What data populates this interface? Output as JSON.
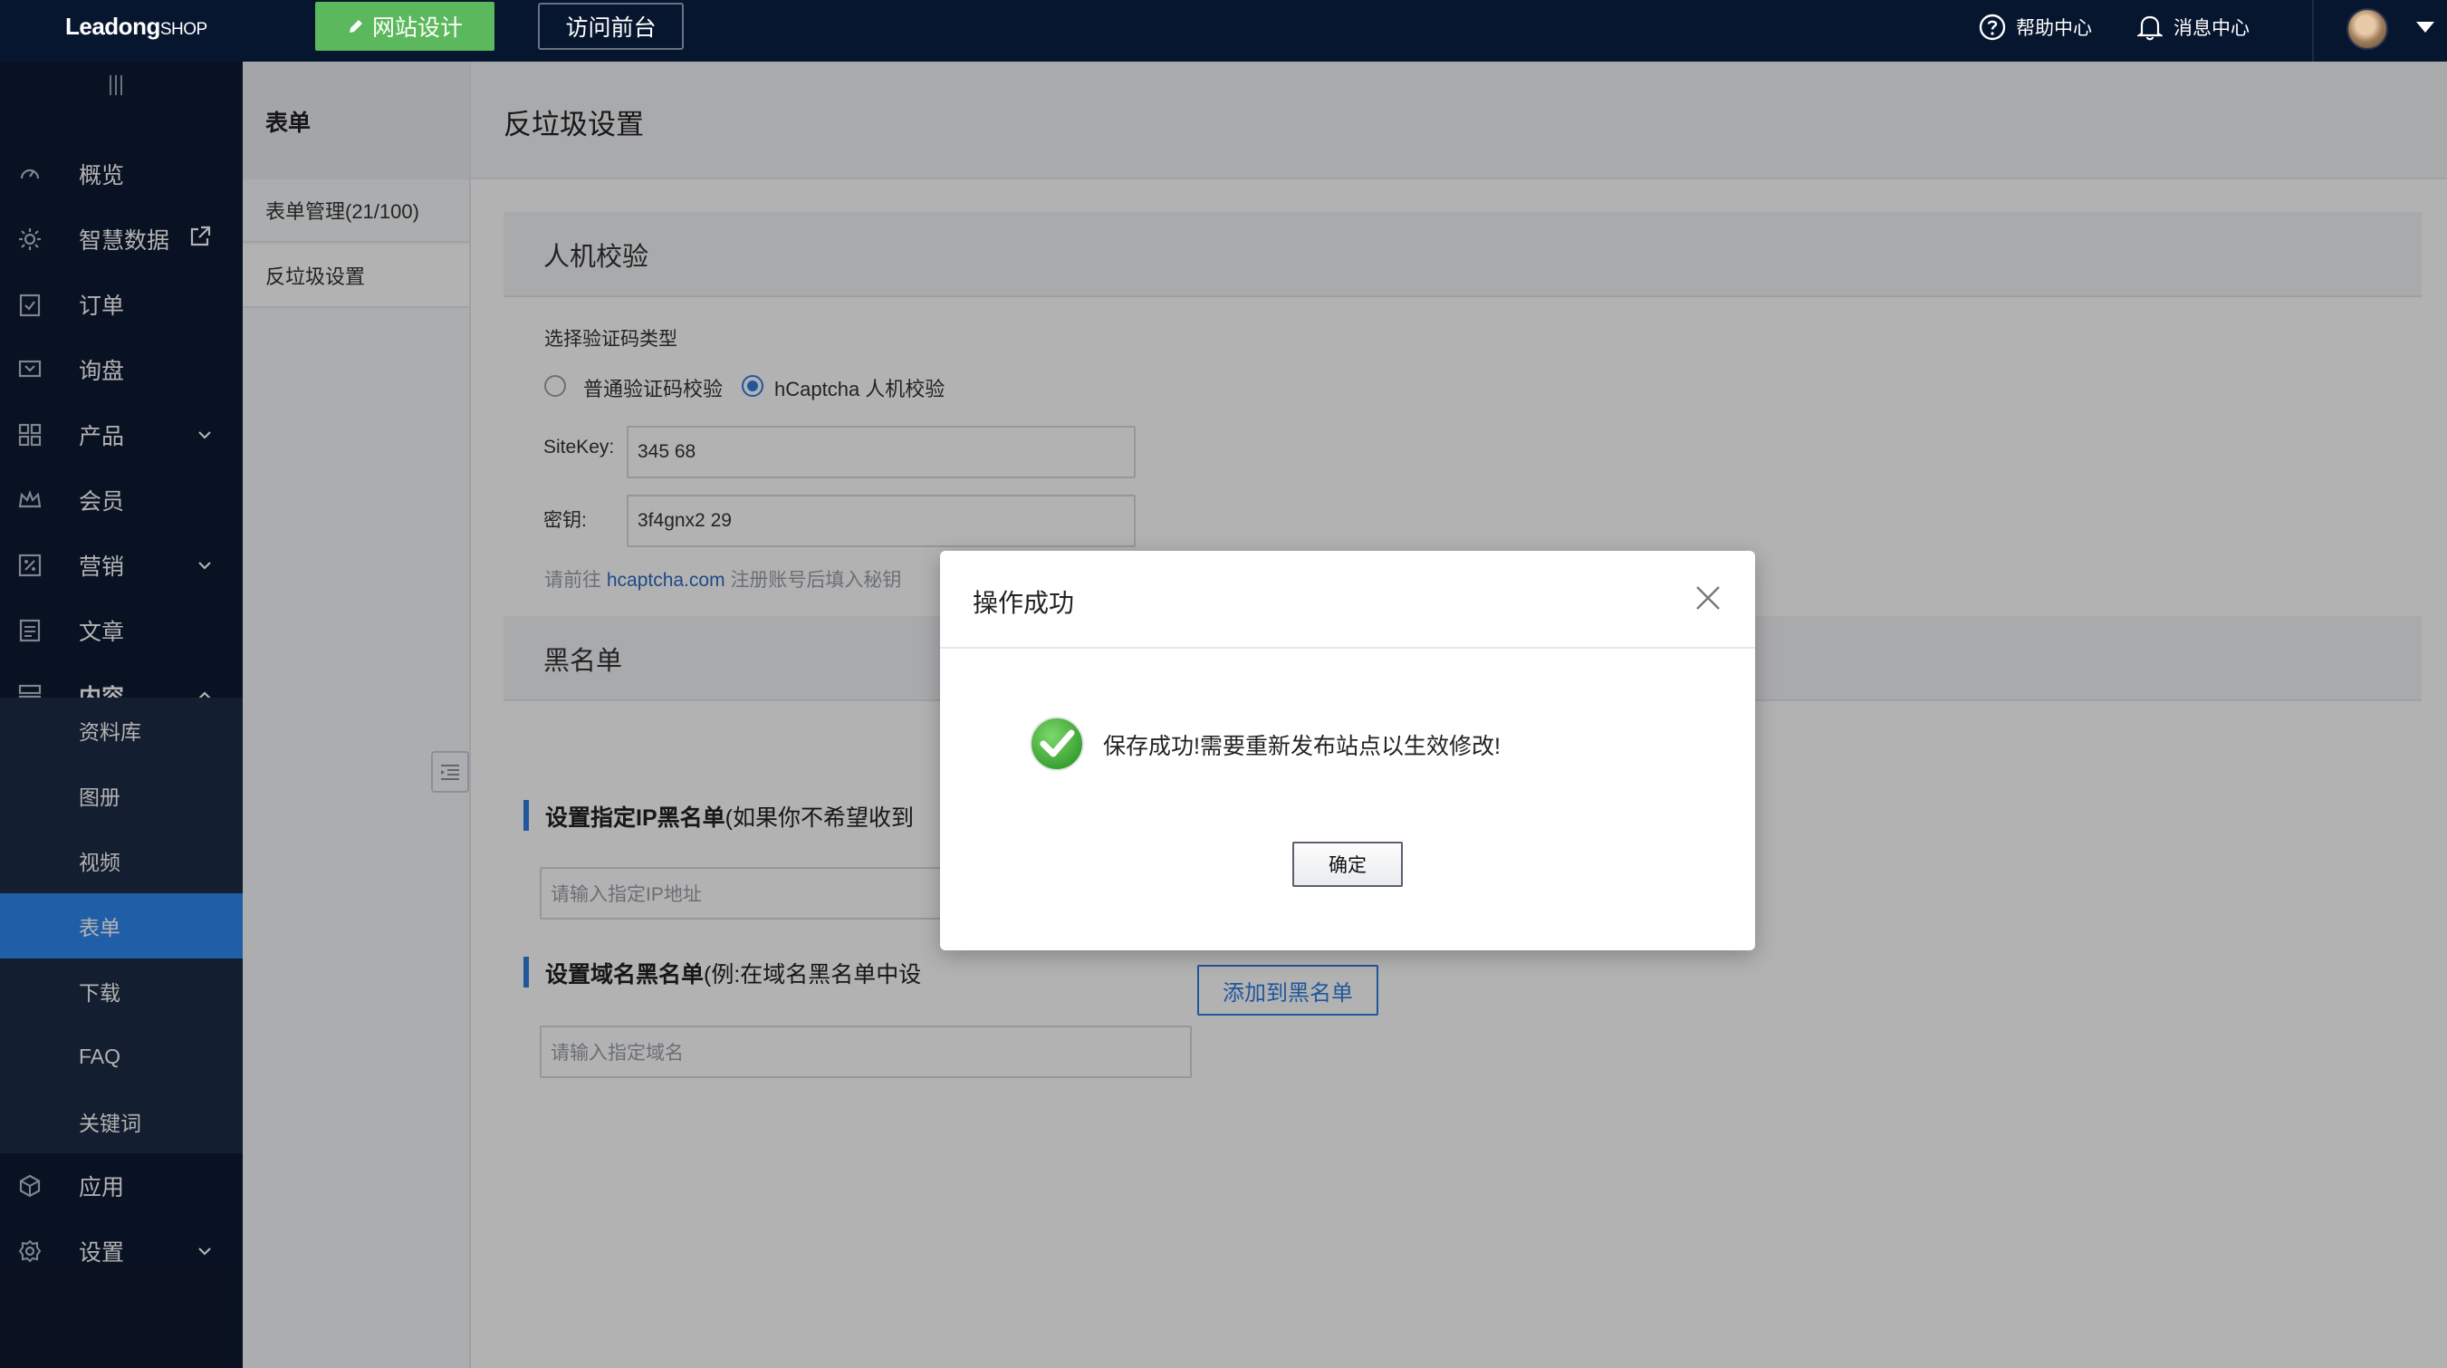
{
  "topbar": {
    "logo_main": "Leadong",
    "logo_suffix": "SHOP",
    "design_button": "网站设计",
    "visit_button": "访问前台",
    "help": "帮助中心",
    "messages": "消息中心"
  },
  "sidebar": {
    "items": [
      {
        "label": "概览",
        "icon": "dashboard-icon"
      },
      {
        "label": "智慧数据",
        "icon": "sun-icon"
      },
      {
        "label": "订单",
        "icon": "clipboard-check-icon"
      },
      {
        "label": "询盘",
        "icon": "inquiry-icon"
      },
      {
        "label": "产品",
        "icon": "grid-icon"
      },
      {
        "label": "会员",
        "icon": "crown-icon"
      },
      {
        "label": "营销",
        "icon": "marketing-icon"
      },
      {
        "label": "文章",
        "icon": "article-icon"
      },
      {
        "label": "内容",
        "icon": "content-icon"
      },
      {
        "label": "应用",
        "icon": "cube-icon"
      },
      {
        "label": "设置",
        "icon": "gear-icon"
      }
    ],
    "sub_items": [
      "资料库",
      "图册",
      "视频",
      "表单",
      "下载",
      "FAQ",
      "关键词"
    ]
  },
  "panel": {
    "title": "表单",
    "items": [
      "表单管理(21/100)",
      "反垃圾设置"
    ]
  },
  "main": {
    "title": "反垃圾设置",
    "captcha": {
      "section_title": "人机校验",
      "type_label": "选择验证码类型",
      "option_normal": "普通验证码校验",
      "option_hcaptcha": "hCaptcha 人机校验",
      "sitekey_label": "SiteKey:",
      "sitekey_value": "345          68",
      "secret_label": "密钥:",
      "secret_value": "3f4gnx2                  29",
      "hint_prefix": "请前往",
      "hint_link": "hcaptcha.com",
      "hint_suffix": "注册账号后填入秘钥"
    },
    "blacklist": {
      "section_title": "黑名单",
      "ip_title": "设置指定IP黑名单",
      "ip_title_rest": "(如果你不希望收到",
      "ip_placeholder": "请输入指定IP地址",
      "domain_title": "设置域名黑名单",
      "domain_title_rest": "(例:在域名黑名单中设",
      "domain_placeholder": "请输入指定域名",
      "add_button": "添加到黑名单"
    }
  },
  "modal": {
    "title": "操作成功",
    "message": "保存成功!需要重新发布站点以生效修改!",
    "ok_button": "确定"
  },
  "colors": {
    "topbar": "#07162f",
    "sidebar": "#0e1a31",
    "active": "#2f88f0",
    "design_button": "#5cb85c",
    "accent": "#2f7de1"
  }
}
